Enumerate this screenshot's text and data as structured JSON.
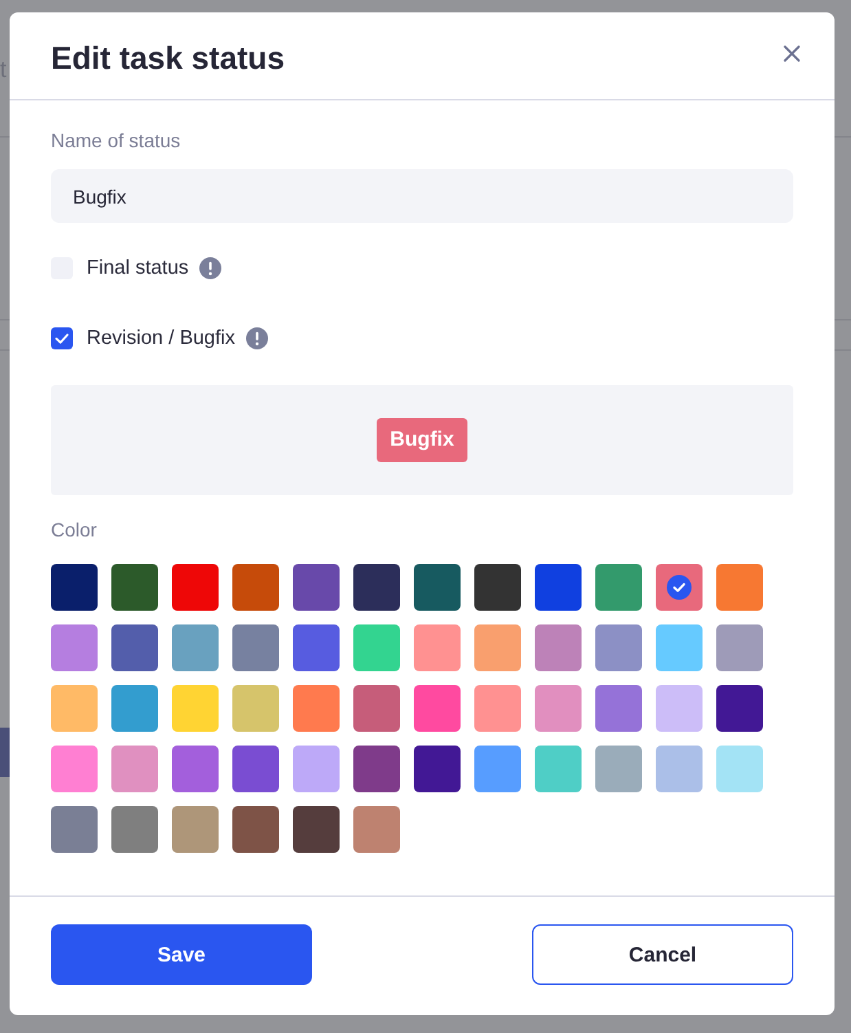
{
  "background_page": {
    "text": "t"
  },
  "dialog": {
    "title": "Edit task status"
  },
  "name_field": {
    "label": "Name of status",
    "value": "Bugfix"
  },
  "options": [
    {
      "label": "Final status",
      "checked": false
    },
    {
      "label": "Revision / Bugfix",
      "checked": true
    }
  ],
  "preview": {
    "label": "Bugfix"
  },
  "colors": {
    "label": "Color",
    "swatches": [
      {
        "color": "#0a1f6b",
        "selected": false
      },
      {
        "color": "#2c5a2a",
        "selected": false
      },
      {
        "color": "#ee0707",
        "selected": false
      },
      {
        "color": "#c64b0a",
        "selected": false
      },
      {
        "color": "#6849aa",
        "selected": false
      },
      {
        "color": "#2c2e5a",
        "selected": false
      },
      {
        "color": "#175a60",
        "selected": false
      },
      {
        "color": "#333333",
        "selected": false
      },
      {
        "color": "#1040e0",
        "selected": false
      },
      {
        "color": "#339a6c",
        "selected": false
      },
      {
        "color": "#e8697c",
        "selected": true
      },
      {
        "color": "#f77832",
        "selected": false
      },
      {
        "color": "#b57ee0",
        "selected": false
      },
      {
        "color": "#535eab",
        "selected": false
      },
      {
        "color": "#69a1bf",
        "selected": false
      },
      {
        "color": "#7781a0",
        "selected": false
      },
      {
        "color": "#575ce0",
        "selected": false
      },
      {
        "color": "#33d490",
        "selected": false
      },
      {
        "color": "#ff9191",
        "selected": false
      },
      {
        "color": "#f99f6e",
        "selected": false
      },
      {
        "color": "#bd82b8",
        "selected": false
      },
      {
        "color": "#8c90c5",
        "selected": false
      },
      {
        "color": "#66caff",
        "selected": false
      },
      {
        "color": "#9e9bb8",
        "selected": false
      },
      {
        "color": "#ffba66",
        "selected": false
      },
      {
        "color": "#339dcf",
        "selected": false
      },
      {
        "color": "#ffd433",
        "selected": false
      },
      {
        "color": "#d6c46b",
        "selected": false
      },
      {
        "color": "#ff7a4e",
        "selected": false
      },
      {
        "color": "#c65d7a",
        "selected": false
      },
      {
        "color": "#ff4aa0",
        "selected": false
      },
      {
        "color": "#ff9191",
        "selected": false
      },
      {
        "color": "#e18fbf",
        "selected": false
      },
      {
        "color": "#9572d8",
        "selected": false
      },
      {
        "color": "#ccbdf8",
        "selected": false
      },
      {
        "color": "#421895",
        "selected": false
      },
      {
        "color": "#ff7fd2",
        "selected": false
      },
      {
        "color": "#e090c0",
        "selected": false
      },
      {
        "color": "#a35fdc",
        "selected": false
      },
      {
        "color": "#7a4dd2",
        "selected": false
      },
      {
        "color": "#bda9f8",
        "selected": false
      },
      {
        "color": "#7f3b8a",
        "selected": false
      },
      {
        "color": "#421895",
        "selected": false
      },
      {
        "color": "#579dff",
        "selected": false
      },
      {
        "color": "#4fcec6",
        "selected": false
      },
      {
        "color": "#9aacba",
        "selected": false
      },
      {
        "color": "#abbfe8",
        "selected": false
      },
      {
        "color": "#a3e3f5",
        "selected": false
      },
      {
        "color": "#7a7f95",
        "selected": false
      },
      {
        "color": "#7f7f7f",
        "selected": false
      },
      {
        "color": "#ae9679",
        "selected": false
      },
      {
        "color": "#7e5347",
        "selected": false
      },
      {
        "color": "#553d3d",
        "selected": false
      },
      {
        "color": "#be8270",
        "selected": false
      }
    ]
  },
  "buttons": [
    {
      "label": "Save",
      "kind": "primary"
    },
    {
      "label": "Cancel",
      "kind": "secondary"
    }
  ]
}
